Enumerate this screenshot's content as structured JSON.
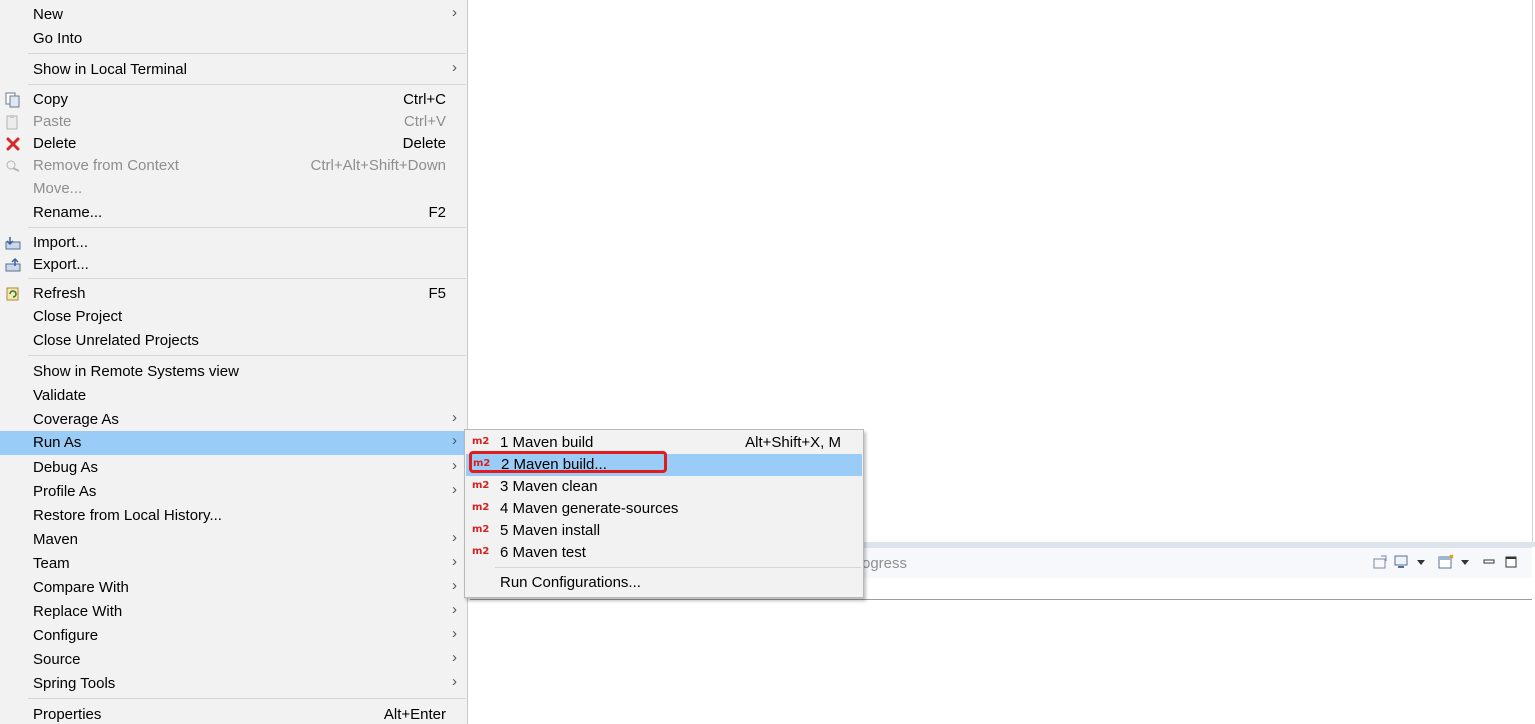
{
  "background": {
    "bottom_view_tab_fragment": "ogress"
  },
  "menu": {
    "items": [
      {
        "label": "New",
        "submenu": true
      },
      {
        "label": "Go Into"
      },
      {
        "label": "Show in Local Terminal",
        "submenu": true
      },
      {
        "label": "Copy",
        "shortcut": "Ctrl+C",
        "icon": "copy-icon"
      },
      {
        "label": "Paste",
        "shortcut": "Ctrl+V",
        "icon": "paste-icon",
        "disabled": true
      },
      {
        "label": "Delete",
        "shortcut": "Delete",
        "icon": "delete-icon"
      },
      {
        "label": "Remove from Context",
        "shortcut": "Ctrl+Alt+Shift+Down",
        "icon": "remove-context-icon",
        "disabled": true
      },
      {
        "label": "Move...",
        "disabled": true
      },
      {
        "label": "Rename...",
        "shortcut": "F2"
      },
      {
        "label": "Import...",
        "icon": "import-icon"
      },
      {
        "label": "Export...",
        "icon": "export-icon"
      },
      {
        "label": "Refresh",
        "shortcut": "F5",
        "icon": "refresh-icon"
      },
      {
        "label": "Close Project"
      },
      {
        "label": "Close Unrelated Projects"
      },
      {
        "label": "Show in Remote Systems view"
      },
      {
        "label": "Validate"
      },
      {
        "label": "Coverage As",
        "submenu": true
      },
      {
        "label": "Run As",
        "submenu": true,
        "selected": true
      },
      {
        "label": "Debug As",
        "submenu": true
      },
      {
        "label": "Profile As",
        "submenu": true
      },
      {
        "label": "Restore from Local History..."
      },
      {
        "label": "Maven",
        "submenu": true
      },
      {
        "label": "Team",
        "submenu": true
      },
      {
        "label": "Compare With",
        "submenu": true
      },
      {
        "label": "Replace With",
        "submenu": true
      },
      {
        "label": "Configure",
        "submenu": true
      },
      {
        "label": "Source",
        "submenu": true
      },
      {
        "label": "Spring Tools",
        "submenu": true
      },
      {
        "label": "Properties",
        "shortcut": "Alt+Enter"
      }
    ]
  },
  "submenu": {
    "icon_text": "m2",
    "items": [
      {
        "label": "1 Maven build",
        "shortcut": "Alt+Shift+X, M"
      },
      {
        "label": "2 Maven build...",
        "selected": true
      },
      {
        "label": "3 Maven clean"
      },
      {
        "label": "4 Maven generate-sources"
      },
      {
        "label": "5 Maven install"
      },
      {
        "label": "6 Maven test"
      },
      {
        "label": "Run Configurations..."
      }
    ]
  },
  "colors": {
    "menu_bg": "#f2f2f2",
    "selection": "#99ccf7",
    "highlight_box": "#e21c1c",
    "disabled_text": "#8e8e8e",
    "m2_icon": "#d42020"
  }
}
